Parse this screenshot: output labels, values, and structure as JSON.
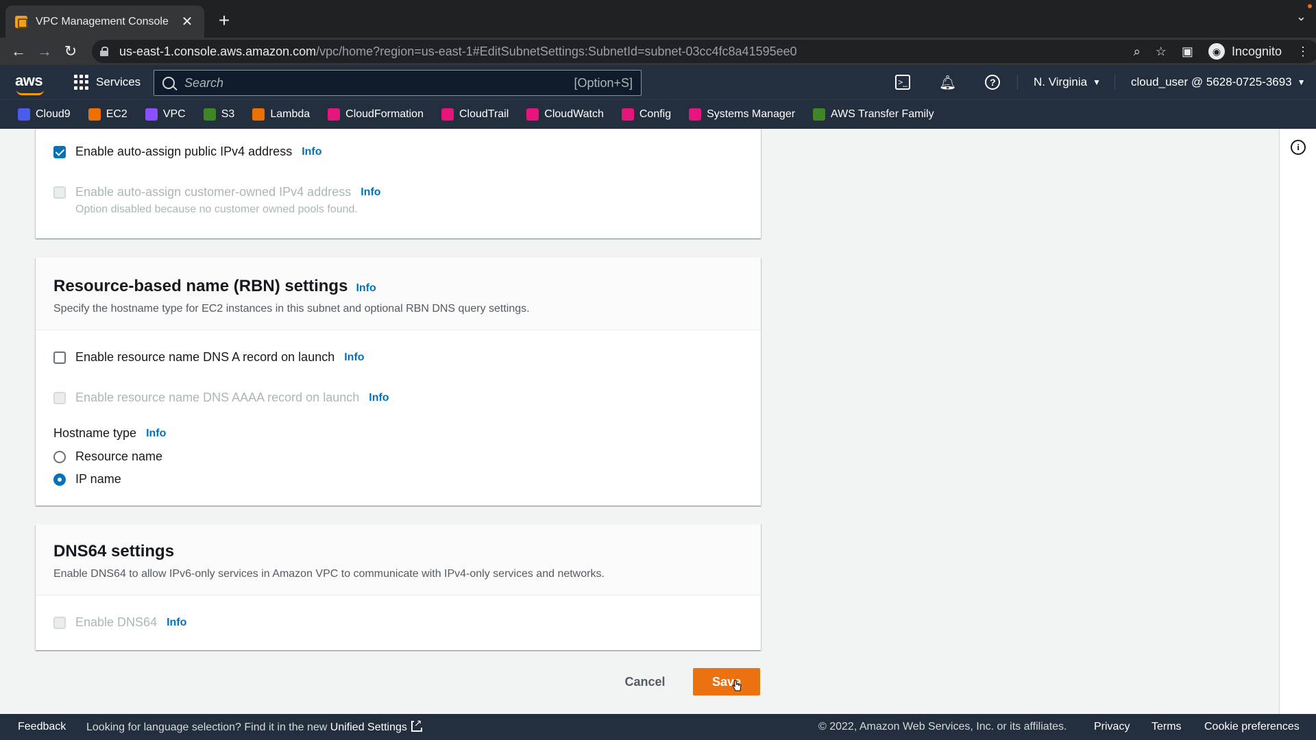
{
  "browser": {
    "tab_title": "VPC Management Console",
    "tab_close": "✕",
    "new_tab": "+",
    "url_host": "us-east-1.console.aws.amazon.com",
    "url_path": "/vpc/home?region=us-east-1#EditSubnetSettings:SubnetId=subnet-03cc4fc8a41595ee0",
    "profile_label": "Incognito"
  },
  "aws_nav": {
    "logo": "aws",
    "services_label": "Services",
    "search_placeholder": "Search",
    "search_shortcut": "[Option+S]",
    "region": "N. Virginia",
    "user": "cloud_user @ 5628-0725-3693"
  },
  "favorites": [
    {
      "label": "Cloud9",
      "color": "#4a5cf0"
    },
    {
      "label": "EC2",
      "color": "#ed7100"
    },
    {
      "label": "VPC",
      "color": "#8c4fff"
    },
    {
      "label": "S3",
      "color": "#3f8624"
    },
    {
      "label": "Lambda",
      "color": "#ed7100"
    },
    {
      "label": "CloudFormation",
      "color": "#e7157b"
    },
    {
      "label": "CloudTrail",
      "color": "#e7157b"
    },
    {
      "label": "CloudWatch",
      "color": "#e7157b"
    },
    {
      "label": "Config",
      "color": "#e7157b"
    },
    {
      "label": "Systems Manager",
      "color": "#e7157b"
    },
    {
      "label": "AWS Transfer Family",
      "color": "#3f8624"
    }
  ],
  "auto_assign": {
    "ipv4_label": "Enable auto-assign public IPv4 address",
    "ipv4_checked": true,
    "customer_label": "Enable auto-assign customer-owned IPv4 address",
    "customer_hint": "Option disabled because no customer owned pools found."
  },
  "rbn": {
    "title": "Resource-based name (RBN) settings",
    "description": "Specify the hostname type for EC2 instances in this subnet and optional RBN DNS query settings.",
    "dns_a_label": "Enable resource name DNS A record on launch",
    "dns_aaaa_label": "Enable resource name DNS AAAA record on launch",
    "hostname_type_label": "Hostname type",
    "options": [
      "Resource name",
      "IP name"
    ],
    "selected_option": "IP name"
  },
  "dns64": {
    "title": "DNS64 settings",
    "description": "Enable DNS64 to allow IPv6-only services in Amazon VPC to communicate with IPv4-only services and networks.",
    "enable_label": "Enable DNS64"
  },
  "info_label": "Info",
  "actions": {
    "cancel": "Cancel",
    "save": "Save"
  },
  "footer": {
    "feedback": "Feedback",
    "lang_text": "Looking for language selection? Find it in the new",
    "lang_link": "Unified Settings",
    "copyright": "© 2022, Amazon Web Services, Inc. or its affiliates.",
    "privacy": "Privacy",
    "terms": "Terms",
    "cookie": "Cookie preferences"
  },
  "colors": {
    "accent": "#0073bb",
    "primary_button": "#ec7211",
    "nav_bg": "#232f3e"
  }
}
